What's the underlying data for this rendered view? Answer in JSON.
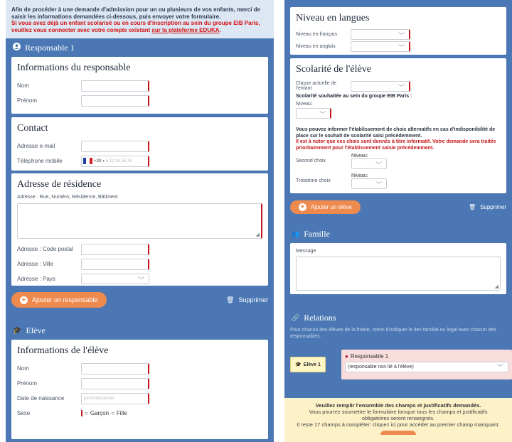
{
  "intro": {
    "line1": "Afin de procéder à une demande d'admission pour un ou plusieurs de vos enfants, merci de saisir les informations demandées ci-dessous, puis envoyer votre formulaire.",
    "line2": "Si vous avez déjà un enfant scolarisé ou en cours d'inscription au sein du groupe EIB Paris, veuillez vous connecter avec votre compte existant",
    "link": "sur la plateforme EDUKA",
    "end": "."
  },
  "responsable": {
    "heading": "Responsable 1",
    "info_title": "Informations du responsable",
    "nom": "Nom",
    "prenom": "Prénom",
    "contact_title": "Contact",
    "email": "Adresse e-mail",
    "phone": "Téléphone mobile",
    "phone_prefix": "+33",
    "phone_placeholder": "6 12 34 56 78",
    "address_title": "Adresse de résidence",
    "street": "Adresse : Rue, Numéro, Résidence, Bâtiment",
    "postal": "Adresse : Code postal",
    "city": "Adresse : Ville",
    "country": "Adresse : Pays",
    "add_btn": "Ajouter un responsable",
    "delete_btn": "Supprimer"
  },
  "eleve": {
    "heading": "Elève",
    "info_title": "Informations de l'élève",
    "nom": "Nom",
    "prenom": "Prénom",
    "dob": "Date de naissance",
    "dob_placeholder": "jour/mois/année",
    "sexe": "Sexe",
    "garcon": "Garçon",
    "fille": "Fille"
  },
  "langues": {
    "title": "Niveau en langues",
    "francais": "Niveau en français",
    "anglais": "Niveau en anglais"
  },
  "scolarite": {
    "title": "Scolarité de l'élève",
    "classe": "Classe actuelle de l'enfant",
    "souhaitee": "Scolarité souhaitée au sein du groupe EIB Paris :",
    "niveau": "Niveau:",
    "info1": "Vous pouvez informer l'établissement de choix alternatifs en cas d'indisponibilité de place sur le souhait de scolarité saisi précédemment.",
    "info2": "Il est à noter que ces choix sont donnés à titre informatif. Votre demande sera traitée prioritairement pour l'établissement saisie précédemment.",
    "second": "Second choix",
    "troisieme": "Troisième choix"
  },
  "right_buttons": {
    "add": "Ajouter un élève",
    "delete": "Supprimer"
  },
  "famille": {
    "heading": "Famille",
    "message": "Message"
  },
  "relations": {
    "heading": "Relations",
    "desc": "Pour chacun des élèves de la fratrie, merci d'indiquer le lien familial ou légal avec chacun des responsables.",
    "eleve_badge": "Elève 1",
    "resp_label": "Responsable 1",
    "resp_value": "(responsable non lié à l'élève)"
  },
  "footer": {
    "line1": "Veuillez remplir l'ensemble des champs et justificatifs demandés.",
    "line2": "Vous pourrez soumettre le formulaire lorsque tous les champs et justificatifs obligatoires seront renseignés.",
    "line3": "Il reste 17 champs à compléter: cliquez ici pour accéder au premier champ manquant."
  },
  "colors": {
    "blue": "#4b78b4",
    "orange": "#ef8a4e",
    "red": "#c4161c"
  }
}
